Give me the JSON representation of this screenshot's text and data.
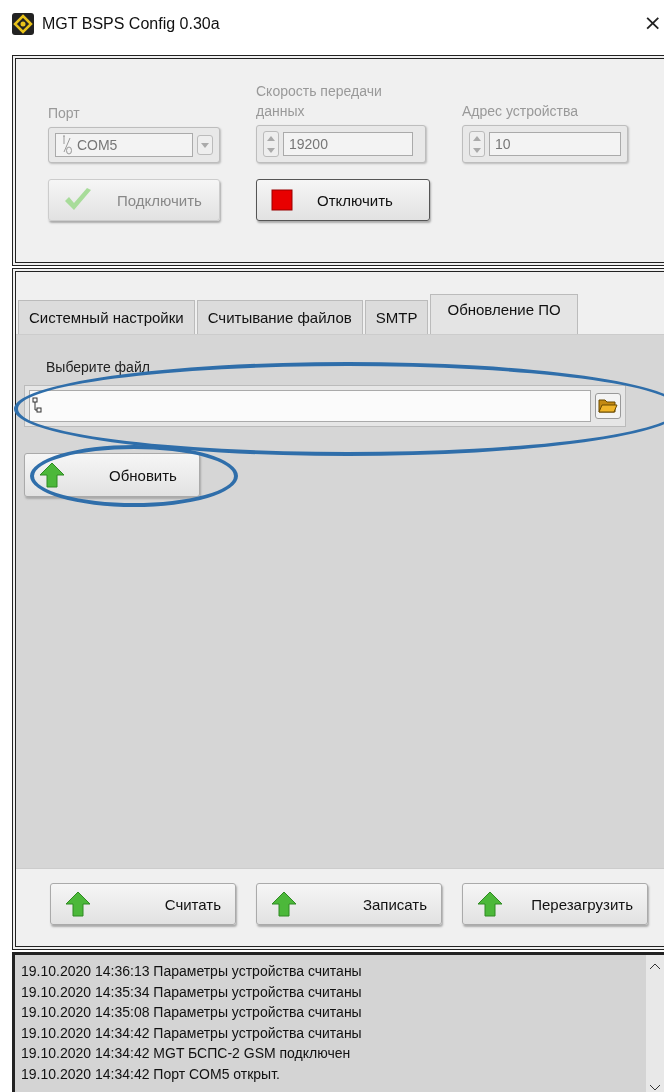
{
  "window": {
    "title": "MGT BSPS Config 0.30a",
    "close": "×"
  },
  "connection": {
    "fields": [
      {
        "kind": "combo",
        "label": "Порт",
        "value": "COM5",
        "disabled": true
      },
      {
        "kind": "spin",
        "label": "Скорость передачи данных",
        "value": "19200",
        "disabled": true
      },
      {
        "kind": "spin",
        "label": "Адрес устройства",
        "value": "10",
        "disabled": true
      }
    ],
    "buttons": [
      {
        "kind": "check",
        "label": "Подключить",
        "disabled": true
      },
      {
        "kind": "stop",
        "label": "Отключить",
        "disabled": false
      }
    ]
  },
  "tabs": [
    {
      "label": "Системный настройки",
      "selected": false
    },
    {
      "label": "Считывание файлов",
      "selected": false
    },
    {
      "label": "SMTP",
      "selected": false
    },
    {
      "label": "Обновление ПО",
      "selected": true
    }
  ],
  "update": {
    "file_label": "Выберите файл",
    "button": "Обновить"
  },
  "actions": [
    "Считать",
    "Записать",
    "Перезагрузить"
  ],
  "log": [
    "19.10.2020 14:36:13 Параметры устройства считаны",
    "19.10.2020 14:35:34 Параметры устройства считаны",
    "19.10.2020 14:35:08 Параметры устройства считаны",
    "19.10.2020 14:34:42 Параметры устройства считаны",
    "19.10.2020 14:34:42 MGT БСПС-2 GSM подключен",
    "19.10.2020 14:34:42 Порт COM5 открыт."
  ]
}
